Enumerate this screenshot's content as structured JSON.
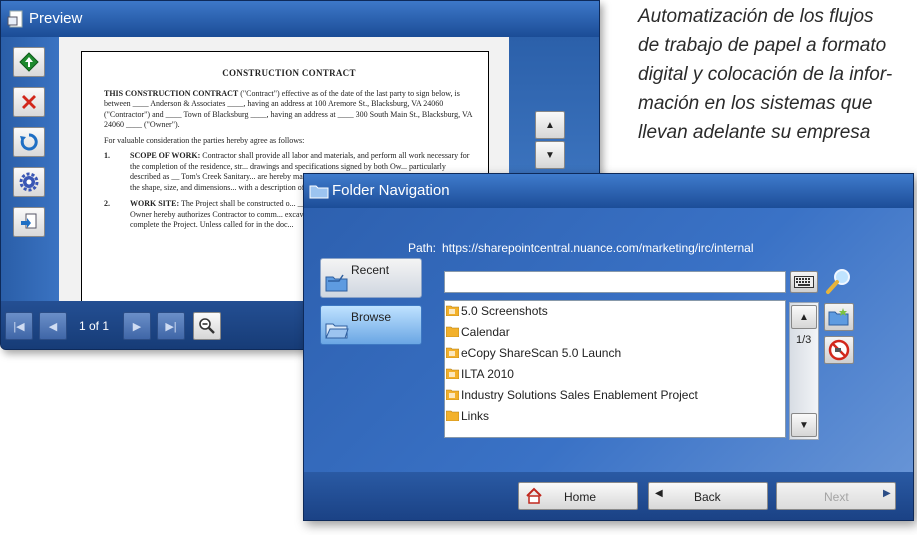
{
  "tagline": {
    "lines": [
      "Automatización de los flujos",
      "de trabajo de papel a formato",
      "digital y colocación de la infor-",
      "mación en los sistemas que",
      "llevan adelante su empresa"
    ]
  },
  "preview": {
    "title": "Preview",
    "page_indicator": "1 of 1",
    "document": {
      "heading": "CONSTRUCTION CONTRACT",
      "intro_lead": "THIS CONSTRUCTION CONTRACT",
      "intro": "(\"Contract\") effective as of the date of the last party to sign below, is between ____ Anderson & Associates ____, having an address at 100 Aremore St., Blacksburg, VA 24060 (\"Contractor\") and ____ Town of Blacksburg ____, having an address at ____ 300 South Main St., Blacksburg, VA 24060 ____ (\"Owner\").",
      "consideration": "For valuable consideration the parties hereby agree as follows:",
      "sections": [
        {
          "num": "1.",
          "lead": "SCOPE OF WORK:",
          "text": "Contractor shall provide all labor and materials, and perform all work necessary for the completion of the residence, str... drawings and specifications signed by both Ow... particularly described as __ Tom's Creek Sanitary... are hereby made a part of this Contract. Drawi... drawing showing the shape, size, and dimensions... with a description of the work to be done, materia... or installed."
        },
        {
          "num": "2.",
          "lead": "WORK SITE:",
          "text": "The Project shall be constructed o... __ Tom's Creek __ and more particularly describ... Owner hereby authorizes Contractor to comm... excavation and grading on the Work Site as may a... complete the Project. Unless called for in the doc..."
        }
      ]
    }
  },
  "folder": {
    "title": "Folder Navigation",
    "path_label": "Path:",
    "path_value": "https://sharepointcentral.nuance.com/marketing/irc/internal",
    "recent_label": "Recent",
    "browse_label": "Browse",
    "search_value": "",
    "items": [
      "5.0 Screenshots",
      "Calendar",
      "eCopy ShareScan 5.0 Launch",
      "ILTA 2010",
      "Industry Solutions Sales Enablement Project",
      "Links"
    ],
    "page_indicator": "1/3",
    "home_label": "Home",
    "back_label": "Back",
    "next_label": "Next"
  },
  "colors": {
    "title_bar": "#1b4c96",
    "window_bg": "#2c5fae",
    "folder_yellow": "#f3b12b",
    "accept_green": "#1e8a2e",
    "cancel_red": "#d2271b"
  }
}
